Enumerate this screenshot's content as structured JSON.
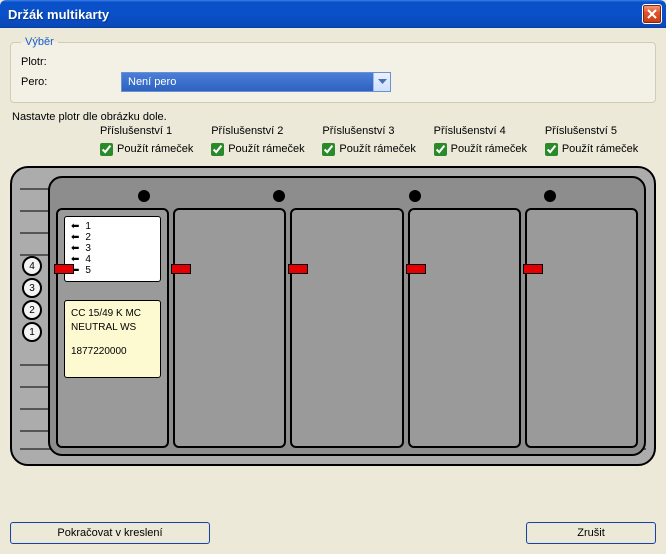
{
  "window": {
    "title": "Držák multikarty"
  },
  "selection": {
    "legend": "Výběr",
    "plotr_label": "Plotr:",
    "pero_label": "Pero:",
    "pero_value": "Není pero"
  },
  "instruction": "Nastavte plotr dle obrázku dole.",
  "accessories": [
    {
      "name": "Příslušenství 1",
      "use_frame_label": "Použít rámeček",
      "checked": true
    },
    {
      "name": "Příslušenství 2",
      "use_frame_label": "Použít rámeček",
      "checked": true
    },
    {
      "name": "Příslušenství 3",
      "use_frame_label": "Použít rámeček",
      "checked": true
    },
    {
      "name": "Příslušenství 4",
      "use_frame_label": "Použít rámeček",
      "checked": true
    },
    {
      "name": "Příslušenství 5",
      "use_frame_label": "Použít rámeček",
      "checked": true
    }
  ],
  "plotter": {
    "stack": [
      "4",
      "3",
      "2",
      "1"
    ],
    "slot1_lines": [
      "1",
      "2",
      "3",
      "4",
      "5"
    ],
    "slot1_note_line1": "CC 15/49 K MC NEUTRAL WS",
    "slot1_note_line2": "1877220000"
  },
  "buttons": {
    "continue": "Pokračovat v kreslení",
    "cancel": "Zrušit"
  }
}
